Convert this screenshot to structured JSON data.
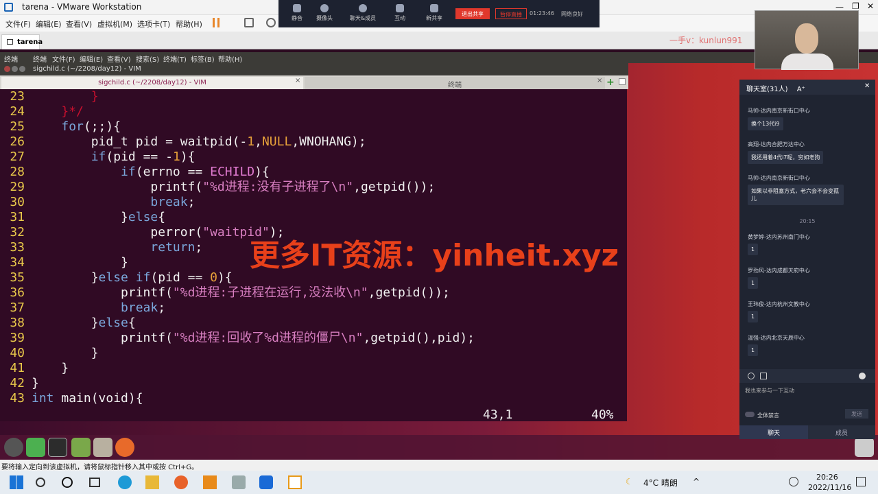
{
  "window": {
    "title": "tarena - VMware Workstation"
  },
  "vmware_menu": [
    "文件(F)",
    "编辑(E)",
    "查看(V)",
    "虚拟机(M)",
    "选项卡(T)",
    "帮助(H)"
  ],
  "vm_tab": "tarena",
  "watermark_top": "一手v：kunlun991",
  "gnome_menu": [
    "终端",
    "终端",
    "文件(F)",
    "编辑(E)",
    "查看(V)",
    "搜索(S)",
    "终端(T)",
    "标签(B)",
    "帮助(H)"
  ],
  "meeting": {
    "items": [
      "静音",
      "摄像头",
      "聊天&成员",
      "互动",
      "新共享"
    ],
    "share": "退出共享",
    "live": "暂停直播",
    "time": "01:23:46",
    "network": "网络良好"
  },
  "terminal": {
    "outer_title": "sigchild.c (~/2208/day12) - VIM",
    "tab1": "sigchild.c (~/2208/day12) - VIM",
    "tab2": "终端",
    "status_pos": "43,1",
    "status_pct": "40%"
  },
  "code_lines": [
    {
      "n": "23",
      "t": "        }"
    },
    {
      "n": "24",
      "t": "    }*/"
    },
    {
      "n": "25",
      "t": "    for(;;){"
    },
    {
      "n": "26",
      "t": "        pid_t pid = waitpid(-1,NULL,WNOHANG);"
    },
    {
      "n": "27",
      "t": "        if(pid == -1){"
    },
    {
      "n": "28",
      "t": "            if(errno == ECHILD){"
    },
    {
      "n": "29",
      "t": "                printf(\"%d进程:没有子进程了\\n\",getpid());"
    },
    {
      "n": "30",
      "t": "                break;"
    },
    {
      "n": "31",
      "t": "            }else{"
    },
    {
      "n": "32",
      "t": "                perror(\"waitpid\");"
    },
    {
      "n": "33",
      "t": "                return;"
    },
    {
      "n": "34",
      "t": "            }"
    },
    {
      "n": "35",
      "t": "        }else if(pid == 0){"
    },
    {
      "n": "36",
      "t": "            printf(\"%d进程:子进程在运行,没法收\\n\",getpid());"
    },
    {
      "n": "37",
      "t": "            break;"
    },
    {
      "n": "38",
      "t": "        }else{"
    },
    {
      "n": "39",
      "t": "            printf(\"%d进程:回收了%d进程的僵尸\\n\",getpid(),pid);"
    },
    {
      "n": "40",
      "t": "        }"
    },
    {
      "n": "41",
      "t": "    }"
    },
    {
      "n": "42",
      "t": "}"
    },
    {
      "n": "43",
      "t": "int main(void){"
    }
  ],
  "big_watermark": "更多IT资源：yinheit.xyz",
  "chat": {
    "header": "聊天室(31人)",
    "font_btn": "A⁺",
    "messages": [
      {
        "name": "马帅-达内南京新街口中心",
        "text": "换个13代i9"
      },
      {
        "name": "高翔-达内合肥万达中心",
        "text": "我还用着4代i7呢，穷如老狗"
      },
      {
        "name": "马帅-达内南京新街口中心",
        "text": "如果以非阻塞方式，老六会不会变孤儿"
      },
      {
        "name": "黄梦婷-达内苏州南门中心",
        "text": "1"
      },
      {
        "name": "罗劲风-达内成都天府中心",
        "text": "1"
      },
      {
        "name": "王玮俊-达内杭州文教中心",
        "text": "1"
      },
      {
        "name": "温强-达内北京天辰中心",
        "text": "1"
      }
    ],
    "time_divider": "20:15",
    "input_placeholder": "我也来参与一下互动",
    "mute_all": "全体禁言",
    "send": "发送",
    "tab_chat": "聊天",
    "tab_members": "成员"
  },
  "vm_status": "要将输入定向到该虚拟机，请将鼠标指针移入其中或按 Ctrl+G。",
  "taskbar": {
    "weather": "4°C 晴朗",
    "time": "20:26",
    "date": "2022/11/16"
  }
}
